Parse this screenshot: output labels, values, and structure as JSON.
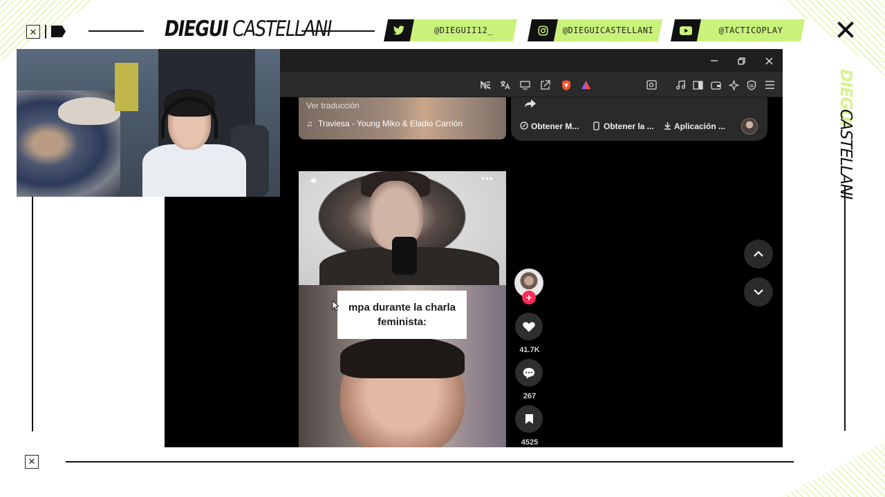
{
  "overlay": {
    "brand_bold": "DIEGUI",
    "brand_light": " CASTELLANI",
    "vertical_brand_top": "DIEGUI",
    "vertical_brand_bottom": "CASTELLANI",
    "accent_color": "#c9f27a",
    "socials": [
      {
        "icon": "twitter-icon",
        "handle": "@DIEGUII12_"
      },
      {
        "icon": "instagram-icon",
        "handle": "@DIEGUICASTELLANI"
      },
      {
        "icon": "youtube-icon",
        "handle": "@TACTICOPLAY"
      }
    ]
  },
  "browser": {
    "window_controls": [
      "minimize",
      "restore",
      "close"
    ],
    "toolbar_icons": [
      "no-reader-icon",
      "translate-icon",
      "cast-icon",
      "share-icon",
      "brave-shields-icon",
      "brave-rewards-icon",
      "zoom-page-icon",
      "music-icon",
      "sidebar-icon",
      "wallet-icon",
      "leo-ai-icon",
      "vpn-icon",
      "menu-icon"
    ]
  },
  "video_card": {
    "translate_label": "Ver traducción",
    "music_label": "Traviesa - Young Miko & Eladio Carrión"
  },
  "action_pill": {
    "items": [
      "Obtener M...",
      "Obtener la ...",
      "Aplicación ..."
    ]
  },
  "video": {
    "overlay_text": "mpa durante la charla\nfeminista:"
  },
  "side_actions": {
    "likes": "41.7K",
    "comments": "267",
    "saves": "4525"
  }
}
